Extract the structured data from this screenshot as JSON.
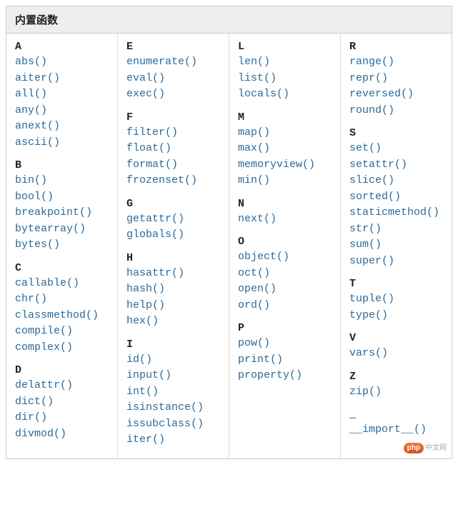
{
  "title": "内置函数",
  "columns": [
    [
      {
        "letter": "A",
        "items": [
          "abs()",
          "aiter()",
          "all()",
          "any()",
          "anext()",
          "ascii()"
        ]
      },
      {
        "letter": "B",
        "items": [
          "bin()",
          "bool()",
          "breakpoint()",
          "bytearray()",
          "bytes()"
        ]
      },
      {
        "letter": "C",
        "items": [
          "callable()",
          "chr()",
          "classmethod()",
          "compile()",
          "complex()"
        ]
      },
      {
        "letter": "D",
        "items": [
          "delattr()",
          "dict()",
          "dir()",
          "divmod()"
        ]
      }
    ],
    [
      {
        "letter": "E",
        "items": [
          "enumerate()",
          "eval()",
          "exec()"
        ]
      },
      {
        "letter": "F",
        "items": [
          "filter()",
          "float()",
          "format()",
          "frozenset()"
        ]
      },
      {
        "letter": "G",
        "items": [
          "getattr()",
          "globals()"
        ]
      },
      {
        "letter": "H",
        "items": [
          "hasattr()",
          "hash()",
          "help()",
          "hex()"
        ]
      },
      {
        "letter": "I",
        "items": [
          "id()",
          "input()",
          "int()",
          "isinstance()",
          "issubclass()",
          "iter()"
        ]
      }
    ],
    [
      {
        "letter": "L",
        "items": [
          "len()",
          "list()",
          "locals()"
        ]
      },
      {
        "letter": "M",
        "items": [
          "map()",
          "max()",
          "memoryview()",
          "min()"
        ]
      },
      {
        "letter": "N",
        "items": [
          "next()"
        ]
      },
      {
        "letter": "O",
        "items": [
          "object()",
          "oct()",
          "open()",
          "ord()"
        ]
      },
      {
        "letter": "P",
        "items": [
          "pow()",
          "print()",
          "property()"
        ]
      }
    ],
    [
      {
        "letter": "R",
        "items": [
          "range()",
          "repr()",
          "reversed()",
          "round()"
        ]
      },
      {
        "letter": "S",
        "items": [
          "set()",
          "setattr()",
          "slice()",
          "sorted()",
          "staticmethod()",
          "str()",
          "sum()",
          "super()"
        ]
      },
      {
        "letter": "T",
        "items": [
          "tuple()",
          "type()"
        ]
      },
      {
        "letter": "V",
        "items": [
          "vars()"
        ]
      },
      {
        "letter": "Z",
        "items": [
          "zip()"
        ]
      },
      {
        "letter": "_",
        "items": [
          "__import__()"
        ]
      }
    ]
  ],
  "watermark": {
    "badge": "php",
    "text": "中文网"
  }
}
